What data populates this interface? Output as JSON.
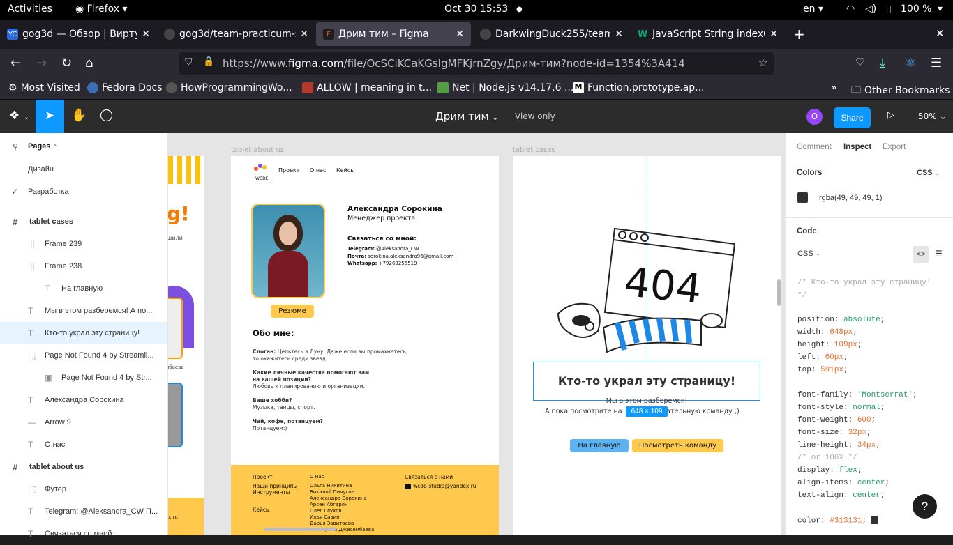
{
  "topbar": {
    "activities": "Activities",
    "app": "Firefox",
    "clock": "Oct 30  15:53",
    "lang": "en",
    "battery": "100 %"
  },
  "tabs": [
    {
      "title": "gog3d — Обзор | Виртуа",
      "fav": "YC"
    },
    {
      "title": "gog3d/team-practicum-st",
      "fav": "gh"
    },
    {
      "title": "Дрим тим – Figma",
      "fav": "F"
    },
    {
      "title": "DarkwingDuck255/team-p",
      "fav": "gh"
    },
    {
      "title": "JavaScript String indexOf(",
      "fav": "W"
    }
  ],
  "url": {
    "prefix": "https://www.",
    "domain": "figma.com",
    "rest": "/file/OcSCiKCaKGsIgMFKjrnZgy/Дрим-тим?node-id=1354%3A414"
  },
  "bookmarks": [
    "Most Visited",
    "Fedora Docs",
    "HowProgrammingWo...",
    "ALLOW | meaning in t...",
    "Net | Node.js v14.17.6 ...",
    "Function.prototype.ap...",
    "Other Bookmarks"
  ],
  "figma": {
    "file": "Дрим тим",
    "view_only": "View only",
    "avatar": "O",
    "share": "Share",
    "zoom": "50%"
  },
  "pages": {
    "header": "Pages",
    "list": [
      "Дизайн",
      "Разработка"
    ]
  },
  "layers": [
    {
      "icon": "#",
      "label": "tablet cases",
      "bold": true,
      "indent": 0
    },
    {
      "icon": "|||",
      "label": "Frame 239",
      "indent": 1
    },
    {
      "icon": "|||",
      "label": "Frame 238",
      "indent": 1
    },
    {
      "icon": "T",
      "label": "На главную",
      "indent": 2
    },
    {
      "icon": "T",
      "label": "Мы в этом разберемся! А по...",
      "indent": 1
    },
    {
      "icon": "T",
      "label": "Кто-то украл эту страницу!",
      "indent": 1,
      "selected": true
    },
    {
      "icon": "⬚",
      "label": "Page Not Found 4 by Streamli...",
      "indent": 1
    },
    {
      "icon": "▣",
      "label": "Page Not Found 4 by Str...",
      "indent": 2
    },
    {
      "icon": "T",
      "label": "Александра Сорокина",
      "indent": 1
    },
    {
      "icon": "—",
      "label": "Arrow 9",
      "indent": 1
    },
    {
      "icon": "T",
      "label": "О нас",
      "indent": 1
    },
    {
      "icon": "#",
      "label": "tablet about us",
      "bold": true,
      "indent": 0
    },
    {
      "icon": "⬚",
      "label": "Футер",
      "indent": 1
    },
    {
      "icon": "T",
      "label": "Telegram: @Aleksandra_CW П...",
      "indent": 1
    },
    {
      "icon": "T",
      "label": "Связаться со мной:",
      "indent": 1
    }
  ],
  "canvas": {
    "frame1_label": "tablet about us",
    "frame2_label": "tablet cases",
    "nav": [
      "Проект",
      "О нас",
      "Кейсы"
    ],
    "logo": "WCDE.",
    "name": "Александра Сорокина",
    "role": "Менеджер проекта",
    "contact_title": "Связаться со мной:",
    "contacts": [
      {
        "k": "Telegram:",
        "v": " @Aleksandra_CW"
      },
      {
        "k": "Почта:",
        "v": " sorokina.aleksandra96@gmail.com"
      },
      {
        "k": "Whatsapp:",
        "v": " +79269255519"
      }
    ],
    "resume": "Резюме",
    "about_title": "Обо мне:",
    "slogan_k": "Слоган:",
    "slogan_v": " Цельтесь в Луну. Даже если вы промахнетесь,",
    "slogan_v2": "то окажитесь среди звезд.",
    "q1": "Какие личные качества помогают вам",
    "q1b": "на вашей позиции?",
    "a1": "Любовь к планированию и организации.",
    "q2": "Ваше хобби?",
    "a2": "Музыка, танцы, спорт.",
    "q3": "Чай, кофе, потанцуем?",
    "a3": "Потанцуем:)",
    "footer": {
      "col1": [
        "Проект",
        "Наши принципы",
        "Инструменты"
      ],
      "col1b": "Кейсы",
      "col2h": "О нас",
      "col2": [
        "Ольга Никитина",
        "Виталий Пичугин",
        "Александра Сорокина",
        "Арсен Абгарян",
        "Олег Глухов",
        "Илья Савин",
        "Дарья Завитаева",
        "Екатерина Джесембаева"
      ],
      "col3h": "Связаться с нами",
      "email": "wcde-studio@yandex.ru"
    },
    "err": "404",
    "headline": "Кто-то украл эту страницу!",
    "sub1": "Мы в этом разберемся!",
    "sub2a": "А пока посмотрите на",
    "sub2b": "чательную команду ;)",
    "dims": "648 × 109",
    "btn1": "На главную",
    "btn2": "Посмотреть команду",
    "left_frag": {
      "g": "g!",
      "sub": "шили",
      "cap": "мбаева",
      "p": "р",
      "ru": "ex.ru"
    }
  },
  "inspect": {
    "tabs": [
      "Comment",
      "Inspect",
      "Export"
    ],
    "colors_title": "Colors",
    "colors_fmt": "CSS",
    "color": "rgba(49, 49, 49, 1)",
    "color_hex": "#313131",
    "code_title": "Code",
    "code_lang": "CSS",
    "comment1": "/* Кто-то украл эту страницу!",
    "comment2": "*/",
    "props": [
      {
        "p": "position",
        "v": "absolute",
        "t": "kw"
      },
      {
        "p": "width",
        "v": "648px",
        "t": "num"
      },
      {
        "p": "height",
        "v": "109px",
        "t": "num"
      },
      {
        "p": "left",
        "v": "60px",
        "t": "num"
      },
      {
        "p": "top",
        "v": "591px",
        "t": "num"
      },
      {
        "p": "",
        "v": "",
        "t": ""
      },
      {
        "p": "font-family",
        "v": "'Montserrat'",
        "t": "str"
      },
      {
        "p": "font-style",
        "v": "normal",
        "t": "kw"
      },
      {
        "p": "font-weight",
        "v": "600",
        "t": "num"
      },
      {
        "p": "font-size",
        "v": "32px",
        "t": "num"
      },
      {
        "p": "line-height",
        "v": "34px",
        "t": "num"
      },
      {
        "p": "/* or 106% */",
        "v": "",
        "t": "cm"
      },
      {
        "p": "display",
        "v": "flex",
        "t": "kw"
      },
      {
        "p": "align-items",
        "v": "center",
        "t": "kw"
      },
      {
        "p": "text-align",
        "v": "center",
        "t": "kw"
      },
      {
        "p": "",
        "v": "",
        "t": ""
      },
      {
        "p": "color",
        "v": "#313131",
        "t": "num"
      }
    ],
    "help": "?"
  }
}
